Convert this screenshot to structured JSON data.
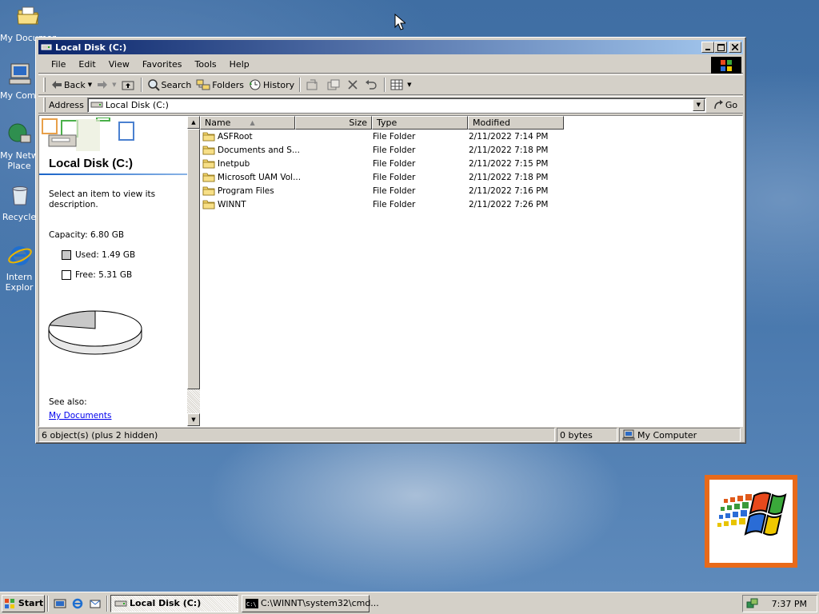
{
  "desktop": {
    "icons": [
      {
        "label": "My Documents",
        "icon": "folder-documents-icon"
      },
      {
        "label": "My Comp",
        "icon": "my-computer-icon"
      },
      {
        "label": "My Netw Place",
        "icon": "network-places-icon"
      },
      {
        "label": "Recycle",
        "icon": "recycle-bin-icon"
      },
      {
        "label": "Intern Explor",
        "icon": "internet-explorer-icon"
      }
    ]
  },
  "window": {
    "title": "Local Disk (C:)",
    "menu": [
      "File",
      "Edit",
      "View",
      "Favorites",
      "Tools",
      "Help"
    ],
    "toolbar": {
      "back": "Back",
      "search": "Search",
      "folders": "Folders",
      "history": "History"
    },
    "address": {
      "label": "Address",
      "value": "Local Disk (C:)",
      "go": "Go"
    },
    "left_pane": {
      "title": "Local Disk (C:)",
      "description": "Select an item to view its description.",
      "capacity": "Capacity: 6.80 GB",
      "used": "Used: 1.49 GB",
      "free": "Free: 5.31 GB",
      "see_also": "See also:",
      "link": "My Documents"
    },
    "columns": [
      "Name",
      "Size",
      "Type",
      "Modified"
    ],
    "files": [
      {
        "name": "ASFRoot",
        "size": "",
        "type": "File Folder",
        "modified": "2/11/2022 7:14 PM"
      },
      {
        "name": "Documents and S...",
        "size": "",
        "type": "File Folder",
        "modified": "2/11/2022 7:18 PM"
      },
      {
        "name": "Inetpub",
        "size": "",
        "type": "File Folder",
        "modified": "2/11/2022 7:15 PM"
      },
      {
        "name": "Microsoft UAM Vol...",
        "size": "",
        "type": "File Folder",
        "modified": "2/11/2022 7:18 PM"
      },
      {
        "name": "Program Files",
        "size": "",
        "type": "File Folder",
        "modified": "2/11/2022 7:16 PM"
      },
      {
        "name": "WINNT",
        "size": "",
        "type": "File Folder",
        "modified": "2/11/2022 7:26 PM"
      }
    ],
    "status": {
      "objects": "6 object(s) (plus 2 hidden)",
      "size": "0 bytes",
      "zone": "My Computer"
    }
  },
  "taskbar": {
    "start": "Start",
    "tasks": [
      {
        "label": "Local Disk (C:)",
        "active": true
      },
      {
        "label": "C:\\WINNT\\system32\\cmd...",
        "active": false
      }
    ],
    "clock": "7:37 PM"
  },
  "colors": {
    "titlebar_start": "#0a246a",
    "titlebar_end": "#a6caf0",
    "chrome": "#d4d0c8",
    "desktop": "#3a6ea5",
    "link": "#0000ee"
  },
  "disk_usage": {
    "used_gb": 1.49,
    "free_gb": 5.31,
    "capacity_gb": 6.8
  }
}
